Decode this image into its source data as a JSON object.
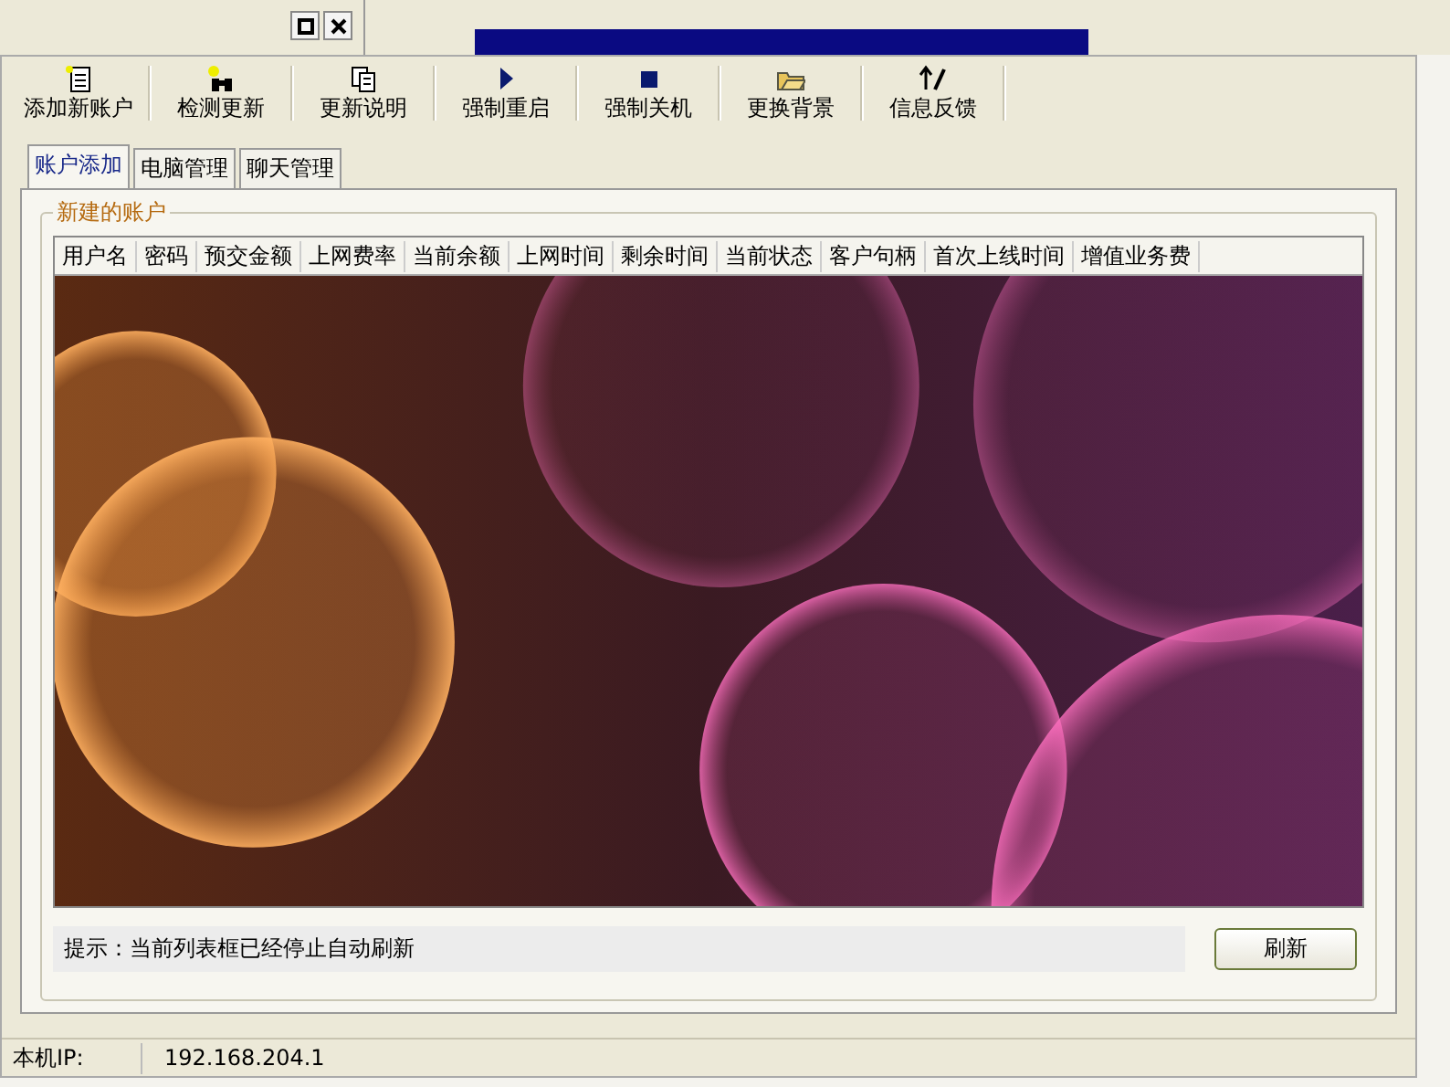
{
  "toolbar": [
    {
      "label": "添加新账户",
      "kind": "doc"
    },
    {
      "label": "检测更新",
      "kind": "bino"
    },
    {
      "label": "更新说明",
      "kind": "pages"
    },
    {
      "label": "强制重启",
      "kind": "play"
    },
    {
      "label": "强制关机",
      "kind": "stop"
    },
    {
      "label": "更换背景",
      "kind": "folder"
    },
    {
      "label": "信息反馈",
      "kind": "pen"
    }
  ],
  "tabs": [
    {
      "label": "账户添加",
      "selected": true
    },
    {
      "label": "电脑管理",
      "selected": false
    },
    {
      "label": "聊天管理",
      "selected": false
    }
  ],
  "group": {
    "title": "新建的账户"
  },
  "table": {
    "columns": [
      "用户名",
      "密码",
      "预交金额",
      "上网费率",
      "当前余额",
      "上网时间",
      "剩余时间",
      "当前状态",
      "客户句柄",
      "首次上线时间",
      "增值业务费"
    ]
  },
  "hint": "提示：当前列表框已经停止自动刷新",
  "refresh_button": "刷新",
  "status_bar": {
    "label": "本机IP:",
    "value": "192.168.204.1"
  }
}
